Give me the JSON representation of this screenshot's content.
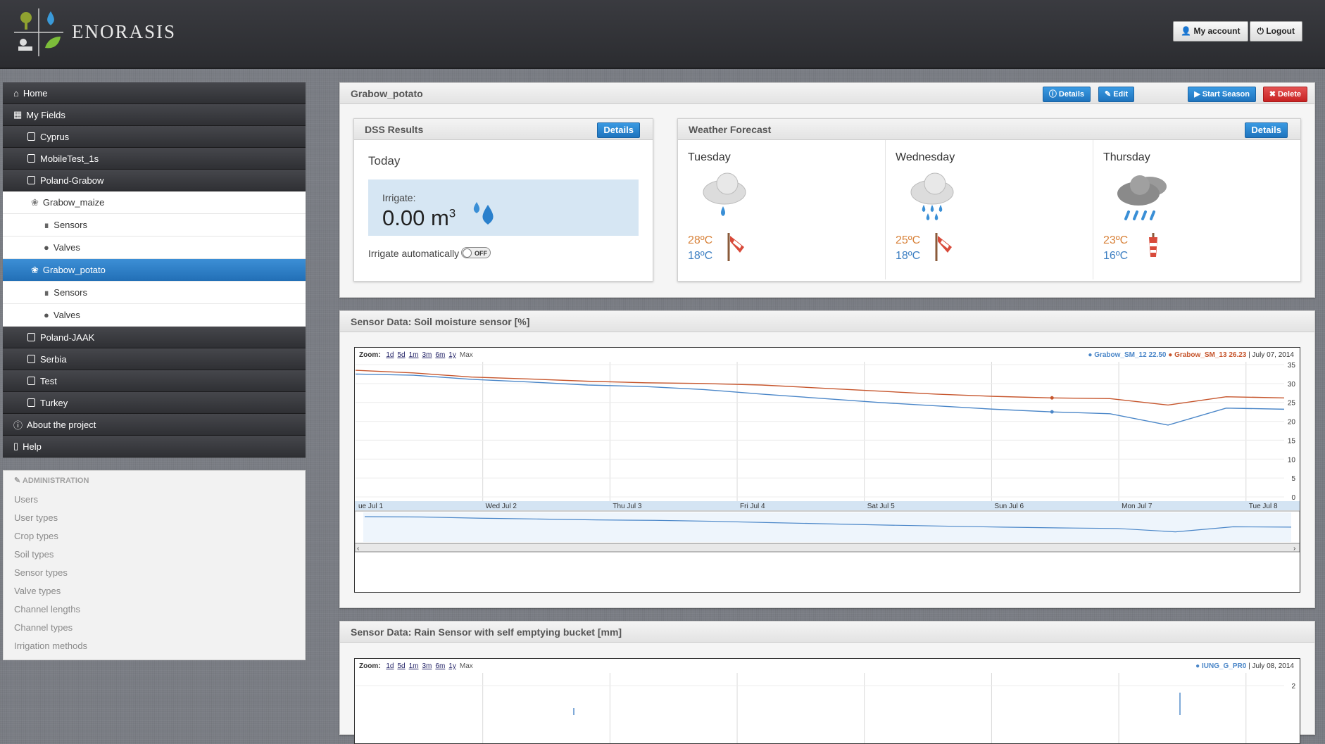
{
  "header": {
    "brand": "ENORASIS",
    "my_account": "My account",
    "logout": "Logout"
  },
  "sidebar": {
    "items": [
      {
        "label": "Home",
        "icon": "home-icon"
      },
      {
        "label": "My Fields",
        "icon": "grid-icon"
      },
      {
        "label": "Cyprus"
      },
      {
        "label": "MobileTest_1s"
      },
      {
        "label": "Poland-Grabow"
      },
      {
        "label": "Grabow_maize"
      },
      {
        "label": "Sensors"
      },
      {
        "label": "Valves"
      },
      {
        "label": "Grabow_potato"
      },
      {
        "label": "Sensors"
      },
      {
        "label": "Valves"
      },
      {
        "label": "Poland-JAAK"
      },
      {
        "label": "Serbia"
      },
      {
        "label": "Test"
      },
      {
        "label": "Turkey"
      },
      {
        "label": "About the project",
        "icon": "info-icon"
      },
      {
        "label": "Help",
        "icon": "book-icon"
      }
    ],
    "admin": {
      "heading": "ADMINISTRATION",
      "items": [
        "Users",
        "User types",
        "Crop types",
        "Soil types",
        "Sensor types",
        "Valve types",
        "Channel lengths",
        "Channel types",
        "Irrigation methods"
      ]
    }
  },
  "main": {
    "title": "Grabow_potato",
    "buttons": {
      "details": "Details",
      "edit": "Edit",
      "start_season": "Start Season",
      "delete": "Delete"
    }
  },
  "dss": {
    "title": "DSS Results",
    "details": "Details",
    "today": "Today",
    "irrigate_label": "Irrigate:",
    "irrigate_value": "0.00 m",
    "irrigate_unit_sup": "3",
    "auto_label": "Irrigate automatically",
    "toggle": "OFF"
  },
  "weather": {
    "title": "Weather Forecast",
    "details": "Details",
    "days": [
      {
        "day": "Tuesday",
        "hi": "28ºC",
        "lo": "18ºC",
        "icon": "cloud-light-rain-icon"
      },
      {
        "day": "Wednesday",
        "hi": "25ºC",
        "lo": "18ºC",
        "icon": "cloud-rain-icon"
      },
      {
        "day": "Thursday",
        "hi": "23ºC",
        "lo": "16ºC",
        "icon": "dark-cloud-heavy-rain-icon"
      }
    ]
  },
  "soil_chart": {
    "title": "Sensor Data: Soil moisture sensor [%]",
    "zoom_label": "Zoom:",
    "zoom": [
      "1d",
      "5d",
      "1m",
      "3m",
      "6m",
      "1y",
      "Max"
    ],
    "legend": {
      "s1": "● Grabow_SM_12 22.50",
      "s2": "● Grabow_SM_13 26.23",
      "date": "| July 07, 2014"
    }
  },
  "rain_chart": {
    "title": "Sensor Data: Rain Sensor with self emptying bucket [mm]",
    "zoom_label": "Zoom:",
    "zoom": [
      "1d",
      "5d",
      "1m",
      "3m",
      "6m",
      "1y",
      "Max"
    ],
    "legend": {
      "s1": "● IUNG_G_PR0",
      "date": "| July 08, 2014"
    }
  },
  "chart_data": [
    {
      "type": "line",
      "title": "Sensor Data: Soil moisture sensor [%]",
      "x": [
        "Jul 1",
        "Jul 1.5",
        "Wed Jul 2",
        "Jul 2.5",
        "Thu Jul 3",
        "Jul 3.5",
        "Fri Jul 4",
        "Jul 4.5",
        "Sat Jul 5",
        "Jul 5.5",
        "Sun Jul 6",
        "Jul 6.5",
        "Mon Jul 7",
        "Jul 7.3",
        "Jul 7.6",
        "Tue Jul 8",
        "Jul 8.3"
      ],
      "xticks": [
        "ue Jul 1",
        "Wed Jul 2",
        "Thu Jul 3",
        "Fri Jul 4",
        "Sat Jul 5",
        "Sun Jul 6",
        "Mon Jul 7",
        "Tue Jul 8"
      ],
      "yticks": [
        0,
        5,
        10,
        15,
        20,
        25,
        30,
        35
      ],
      "ylim": [
        0,
        35
      ],
      "series": [
        {
          "name": "Grabow_SM_12",
          "color": "#4a86c8",
          "values": [
            32.5,
            32.2,
            31.1,
            30.4,
            29.6,
            29.2,
            28.4,
            27.2,
            26.1,
            25.0,
            24.1,
            23.2,
            22.5,
            22.0,
            19.0,
            23.5,
            23.2
          ]
        },
        {
          "name": "Grabow_SM_13",
          "color": "#c6552c",
          "values": [
            33.5,
            32.8,
            31.7,
            31.2,
            30.6,
            30.2,
            30.0,
            29.6,
            28.8,
            28.0,
            27.2,
            26.6,
            26.2,
            26.0,
            24.3,
            26.5,
            26.2
          ]
        }
      ]
    },
    {
      "type": "line",
      "title": "Sensor Data: Rain Sensor with self emptying bucket [mm]",
      "xticks": [],
      "yticks": [
        2
      ],
      "series": [
        {
          "name": "IUNG_G_PR0",
          "color": "#4a86c8"
        }
      ]
    }
  ]
}
